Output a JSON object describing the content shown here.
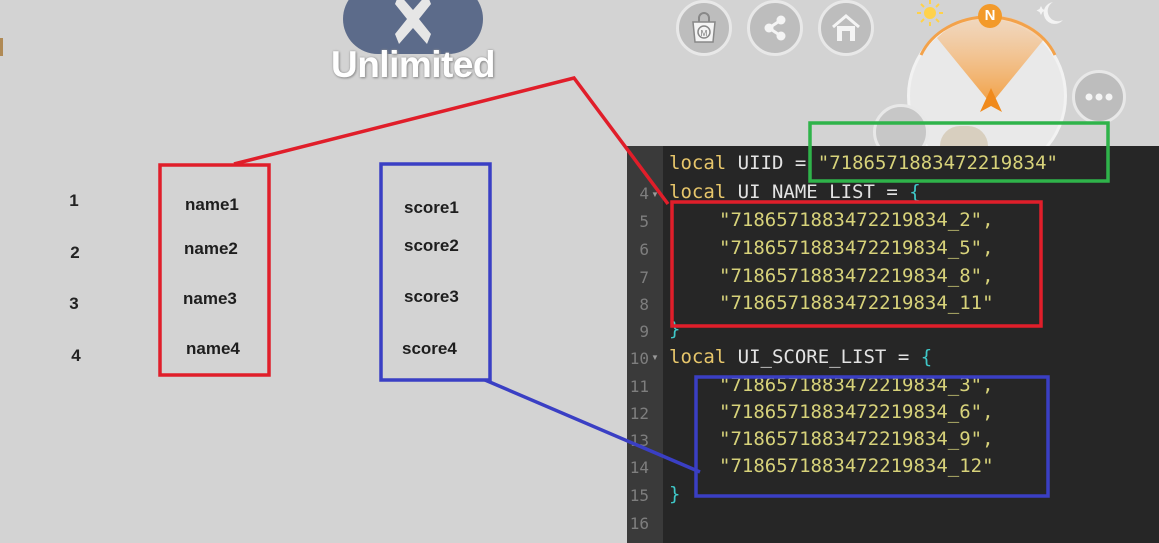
{
  "header": {
    "mode_label": "Unlimited"
  },
  "toolbar": {
    "buttons": [
      {
        "name": "shop-button",
        "icon": "shopping-bag-icon",
        "glyph": "M"
      },
      {
        "name": "share-button",
        "icon": "share-icon"
      },
      {
        "name": "home-button",
        "icon": "home-icon"
      }
    ],
    "compass_north": "N",
    "more_icon": "ellipsis-icon"
  },
  "leaderboard": {
    "rows": [
      {
        "rank": "1",
        "name": "name1",
        "score": "score1"
      },
      {
        "rank": "2",
        "name": "name2",
        "score": "score2"
      },
      {
        "rank": "3",
        "name": "name3",
        "score": "score3"
      },
      {
        "rank": "4",
        "name": "name4",
        "score": "score4"
      }
    ]
  },
  "editor": {
    "line_numbers": [
      "4",
      "5",
      "6",
      "7",
      "8",
      "9",
      "10",
      "11",
      "12",
      "13",
      "14",
      "15",
      "16"
    ],
    "uiid_line": {
      "kw": "local",
      "name": "UIID",
      "op": "=",
      "value": "\"7186571883472219834\""
    },
    "name_list_decl": {
      "kw": "local",
      "name": "UI_NAME_LIST",
      "op": "=",
      "brace": "{"
    },
    "name_list": [
      "\"7186571883472219834_2\",",
      "\"7186571883472219834_5\",",
      "\"7186571883472219834_8\",",
      "\"7186571883472219834_11\""
    ],
    "close_brace": "}",
    "score_list_decl": {
      "kw": "local",
      "name": "UI_SCORE_LIST",
      "op": "=",
      "brace": "{"
    },
    "score_list": [
      "\"7186571883472219834_3\",",
      "\"7186571883472219834_6\",",
      "\"7186571883472219834_9\",",
      "\"7186571883472219834_12\""
    ]
  },
  "colors": {
    "annotation_red": "#e01e2a",
    "annotation_blue": "#3a3fc4",
    "annotation_green": "#2fb34a",
    "editor_bg": "#262626"
  }
}
